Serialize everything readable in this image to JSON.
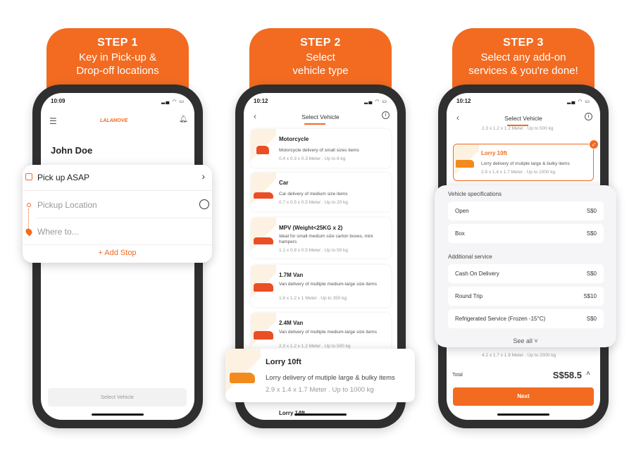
{
  "steps": [
    {
      "title": "STEP 1",
      "subtitle_lines": [
        "Key in Pick-up &",
        "Drop-off locations"
      ]
    },
    {
      "title": "STEP 2",
      "subtitle_lines": [
        "Select",
        "vehicle type"
      ]
    },
    {
      "title": "STEP 3",
      "subtitle_lines": [
        "Select any add-on",
        "services & you're done!"
      ]
    }
  ],
  "colors": {
    "brand": "#f26b21",
    "bezel": "#2f2f2f"
  },
  "screen1": {
    "time": "10:09",
    "logo": "LALAMOVE",
    "user_name": "John Doe",
    "pickup_time": "Pick up ASAP",
    "pickup_placeholder": "Pickup Location",
    "dropoff_placeholder": "Where to...",
    "add_stop": "+ Add Stop",
    "select_vehicle_button": "Select Vehicle"
  },
  "screen2": {
    "time": "10:12",
    "title": "Select Vehicle",
    "vehicles": [
      {
        "name": "Motorcycle",
        "desc": "Motorcycle delivery of small sizes items",
        "dims": "0.4 x 0.3 x 0.3 Meter . Up to 8 kg"
      },
      {
        "name": "Car",
        "desc": "Car delivery of medium size items",
        "dims": "0.7 x 0.5 x 0.5 Meter . Up to 20 kg"
      },
      {
        "name": "MPV (Weight<25KG x 2)",
        "desc": "Ideal for small medium size carton boxes, mini hampers",
        "dims": "1.1 x 0.8 x 0.5 Meter . Up to 50 kg"
      },
      {
        "name": "1.7M Van",
        "desc": "Van delivery of multiple medium-large size items",
        "dims": "1.6 x 1.2 x 1 Meter . Up to 350 kg"
      },
      {
        "name": "2.4M Van",
        "desc": "Van delivery of multiple medium-large size items",
        "dims": "2.3 x 1.2 x 1.2 Meter . Up to 500 kg"
      }
    ],
    "highlight": {
      "name": "Lorry 10ft",
      "desc": "Lorry delivery of mutiple large & bulky items",
      "dims": "2.9 x 1.4 x 1.7 Meter . Up to 1000 kg"
    },
    "next_partial": "Lorry 14ft"
  },
  "screen3": {
    "time": "10:12",
    "title": "Select Vehicle",
    "prev_dims": "2.3 x 1.2 x 1.2 Meter . Up to 500 kg",
    "selected": {
      "name": "Lorry 10ft",
      "desc": "Lorry delivery of mutiple large & bulky items",
      "dims": "2.9 x 1.4 x 1.7 Meter . Up to 1000 kg"
    },
    "spec_heading": "Vehicle specifications",
    "specs": [
      {
        "label": "Open",
        "price": "S$0"
      },
      {
        "label": "Box",
        "price": "S$0"
      }
    ],
    "service_heading": "Additional service",
    "services": [
      {
        "label": "Cash On Delivery",
        "price": "S$0"
      },
      {
        "label": "Round Trip",
        "price": "S$10"
      },
      {
        "label": "Refrigerated Service (Frozen -15°C)",
        "price": "S$0"
      }
    ],
    "see_all": "See all",
    "behind_dims": "4.2 x 1.7 x 1.9 Meter . Up to 2000 kg",
    "total_label": "Total",
    "total_value": "S$58.5",
    "next_button": "Next"
  }
}
